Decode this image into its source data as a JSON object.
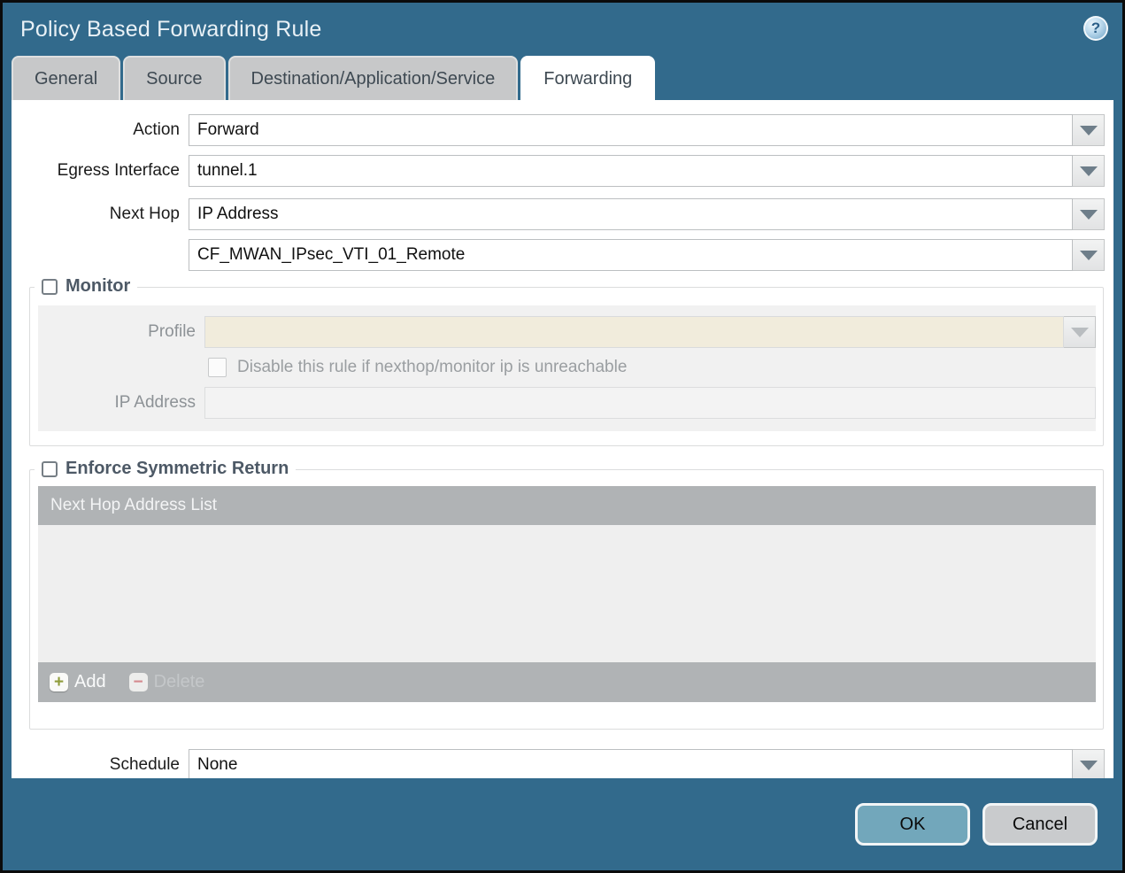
{
  "dialog": {
    "title": "Policy Based Forwarding Rule",
    "help_glyph": "?"
  },
  "tabs": [
    {
      "label": "General",
      "active": false
    },
    {
      "label": "Source",
      "active": false
    },
    {
      "label": "Destination/Application/Service",
      "active": false
    },
    {
      "label": "Forwarding",
      "active": true
    }
  ],
  "form": {
    "action": {
      "label": "Action",
      "value": "Forward"
    },
    "egress_interface": {
      "label": "Egress Interface",
      "value": "tunnel.1"
    },
    "next_hop": {
      "label": "Next Hop",
      "value": "IP Address"
    },
    "next_hop_address": {
      "value": "CF_MWAN_IPsec_VTI_01_Remote"
    },
    "schedule": {
      "label": "Schedule",
      "value": "None"
    }
  },
  "monitor": {
    "title": "Monitor",
    "checked": false,
    "profile": {
      "label": "Profile",
      "value": ""
    },
    "disable_rule_label": "Disable this rule if nexthop/monitor ip is unreachable",
    "disable_rule_checked": false,
    "ip_address": {
      "label": "IP Address",
      "value": ""
    }
  },
  "symmetric_return": {
    "title": "Enforce Symmetric Return",
    "checked": false,
    "table_header": "Next Hop Address List",
    "rows": [],
    "add_label": "Add",
    "delete_label": "Delete",
    "delete_enabled": false
  },
  "footer": {
    "ok_label": "OK",
    "cancel_label": "Cancel"
  },
  "colors": {
    "frame_teal": "#326A8C",
    "tab_inactive": "#C7C8C9",
    "fieldset_title": "#4D5966",
    "profile_disabled_fill": "#F1ECDC",
    "table_bar": "#B0B3B5",
    "ok_button": "#72A7BB",
    "cancel_button": "#C9CBCD"
  }
}
